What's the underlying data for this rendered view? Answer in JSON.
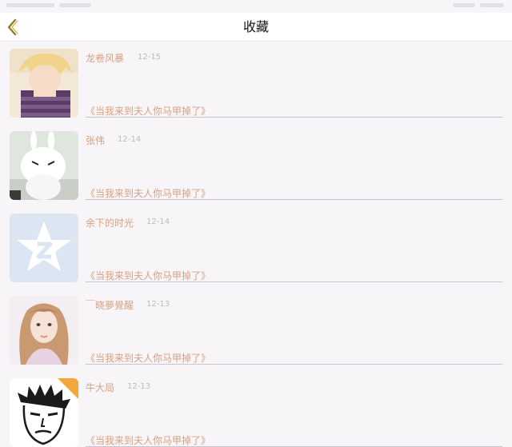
{
  "header": {
    "title": "收藏",
    "back_icon": "chevron-left-icon",
    "accent": "#8a7a1e"
  },
  "colors": {
    "name": "#d7a180",
    "date": "#bdbdbd",
    "divider": "#c8c6cb"
  },
  "items": [
    {
      "name": "龙卷风暴",
      "date": "12-15",
      "book": "《当我来到夫人你马甲掉了》",
      "avatar": "anime-boy-avatar"
    },
    {
      "name": "张伟",
      "date": "12-14",
      "book": "《当我来到夫人你马甲掉了》",
      "avatar": "white-rabbit-avatar"
    },
    {
      "name": "余下的时光",
      "date": "12-14",
      "book": "《当我来到夫人你马甲掉了》",
      "avatar": "qq-logo-avatar"
    },
    {
      "name": "￣晓夢覺醒",
      "date": "12-13",
      "book": "《当我来到夫人你马甲掉了》",
      "avatar": "girl-portrait-avatar"
    },
    {
      "name": "牛大局",
      "date": "12-13",
      "book": "《当我来到夫人你马甲掉了》",
      "avatar": "sketch-face-avatar"
    }
  ]
}
